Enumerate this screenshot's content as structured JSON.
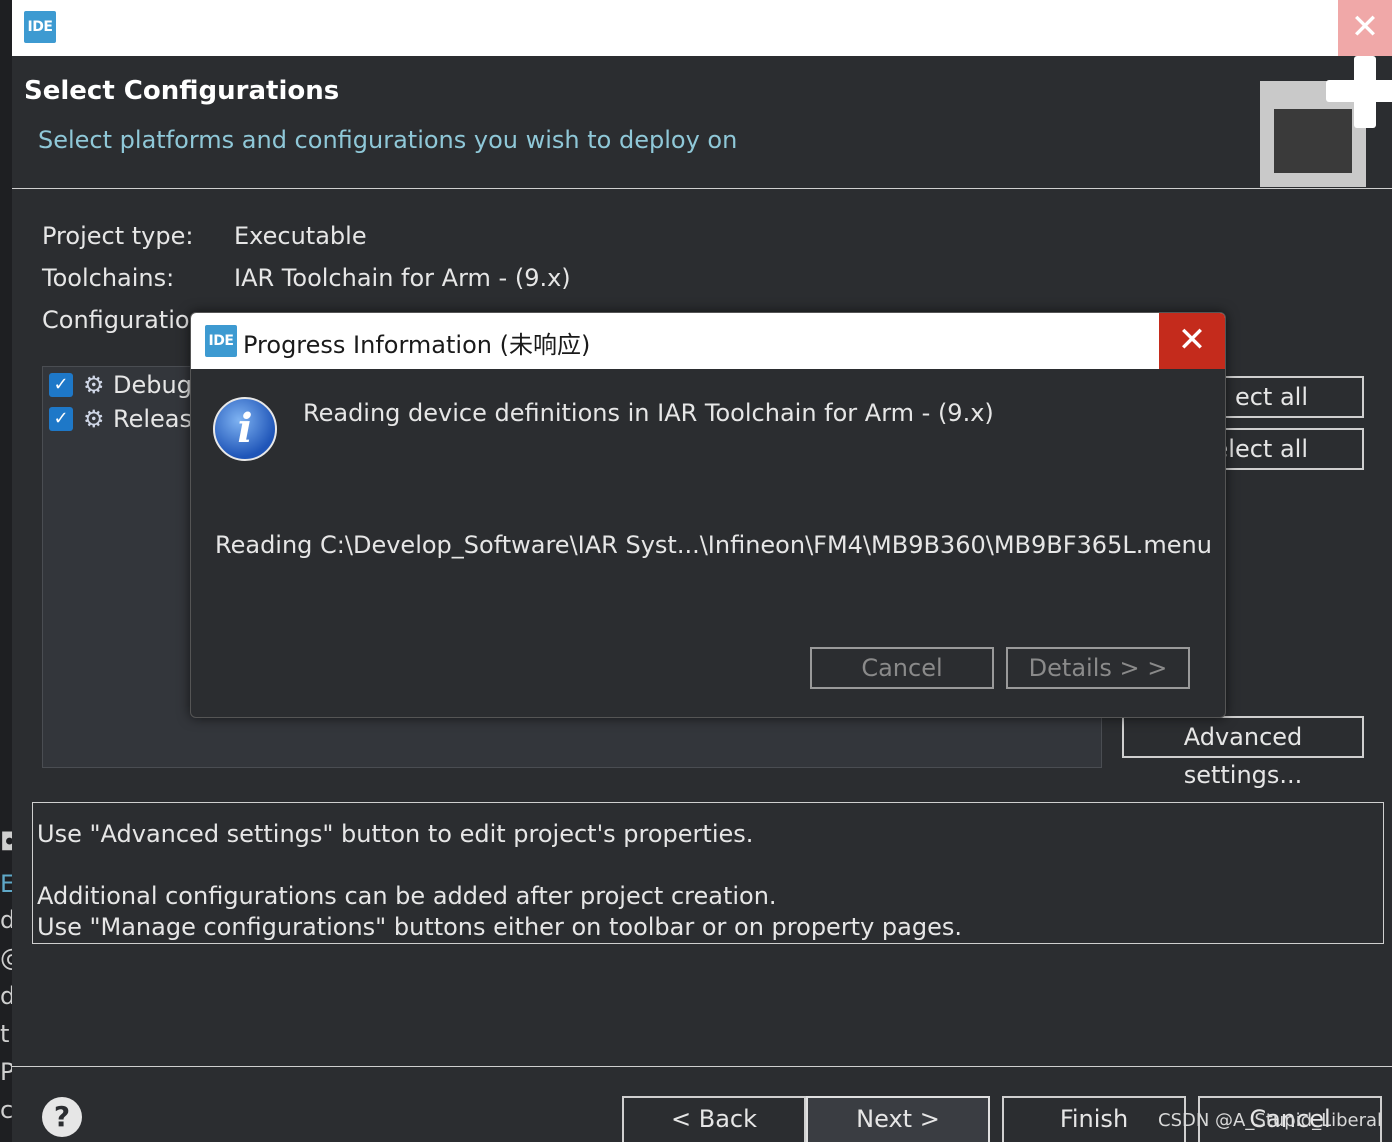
{
  "window": {
    "logo_text": "IDE",
    "close_glyph": "✕"
  },
  "header": {
    "title": "Select Configurations",
    "subtitle": "Select platforms and configurations you wish to deploy on"
  },
  "project_info": {
    "project_type_label": "Project type:",
    "project_type_value": "Executable",
    "toolchains_label": "Toolchains:",
    "toolchains_value": "IAR Toolchain for Arm - (9.x)",
    "configurations_label": "Configuration"
  },
  "configurations": [
    {
      "label": "Debug",
      "checked": true
    },
    {
      "label": "Releas",
      "checked": true
    }
  ],
  "side_buttons": {
    "select_all": "ect all",
    "deselect_all": "elect all",
    "advanced_settings": "Advanced settings..."
  },
  "notes": {
    "line1": "Use \"Advanced settings\" button to edit project's properties.",
    "line2": "Additional configurations can be added after project creation.",
    "line3": "Use \"Manage configurations\" buttons either on toolbar or on property pages."
  },
  "footer": {
    "help": "?",
    "back": "< Back",
    "next": "Next >",
    "finish": "Finish",
    "cancel": "Cancel"
  },
  "watermark": "CSDN @A_Stupid_Liberal",
  "left_fragments": [
    "◘",
    "El",
    "d",
    "@",
    "d",
    "t",
    "P",
    "c"
  ],
  "modal": {
    "title": "Progress Information (未响应)",
    "close_glyph": "✕",
    "info_glyph": "i",
    "message": "Reading device definitions in IAR Toolchain for Arm - (9.x)",
    "reading": "Reading C:\\Develop_Software\\IAR Syst...\\Infineon\\FM4\\MB9B360\\MB9BF365L.menu",
    "cancel": "Cancel",
    "details": "Details > >"
  }
}
